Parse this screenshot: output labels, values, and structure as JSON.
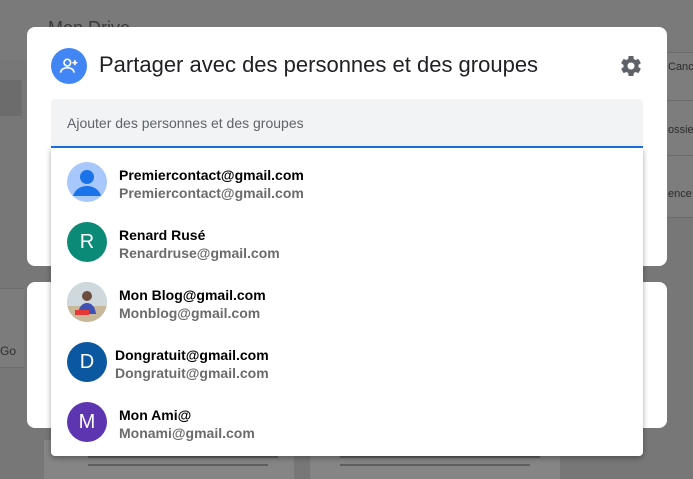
{
  "background": {
    "drive_title": "Mon Drive",
    "go_label": "Go",
    "right_labels": [
      "Canc",
      "ossie",
      "ence"
    ]
  },
  "dialog": {
    "title": "Partager avec des personnes et des groupes",
    "share_icon": "person-add-icon",
    "settings_icon": "gear-icon",
    "search": {
      "placeholder": "Ajouter des personnes et des groupes",
      "value": ""
    }
  },
  "suggestions": [
    {
      "name": "Premiercontact@gmail.com",
      "email": "Premiercontact@gmail.com",
      "avatar_type": "default",
      "initial": "",
      "color": "#a8c7fa"
    },
    {
      "name": "Renard Rusé",
      "email": "Renardruse@gmail.com",
      "avatar_type": "letter",
      "initial": "R",
      "color": "#0b8a78"
    },
    {
      "name": "Mon Blog@gmail.com",
      "email": "Monblog@gmail.com",
      "avatar_type": "photo",
      "initial": "",
      "color": "#d9d4cc"
    },
    {
      "name": "Dongratuit@gmail.com",
      "email": "Dongratuit@gmail.com",
      "avatar_type": "letter",
      "initial": "D",
      "color": "#0b57a0"
    },
    {
      "name": "Mon Ami@",
      "email": "Monami@gmail.com",
      "avatar_type": "letter",
      "initial": "M",
      "color": "#5e35b1"
    }
  ],
  "colors": {
    "accent": "#1a73e8",
    "share_avatar": "#4285f4"
  }
}
